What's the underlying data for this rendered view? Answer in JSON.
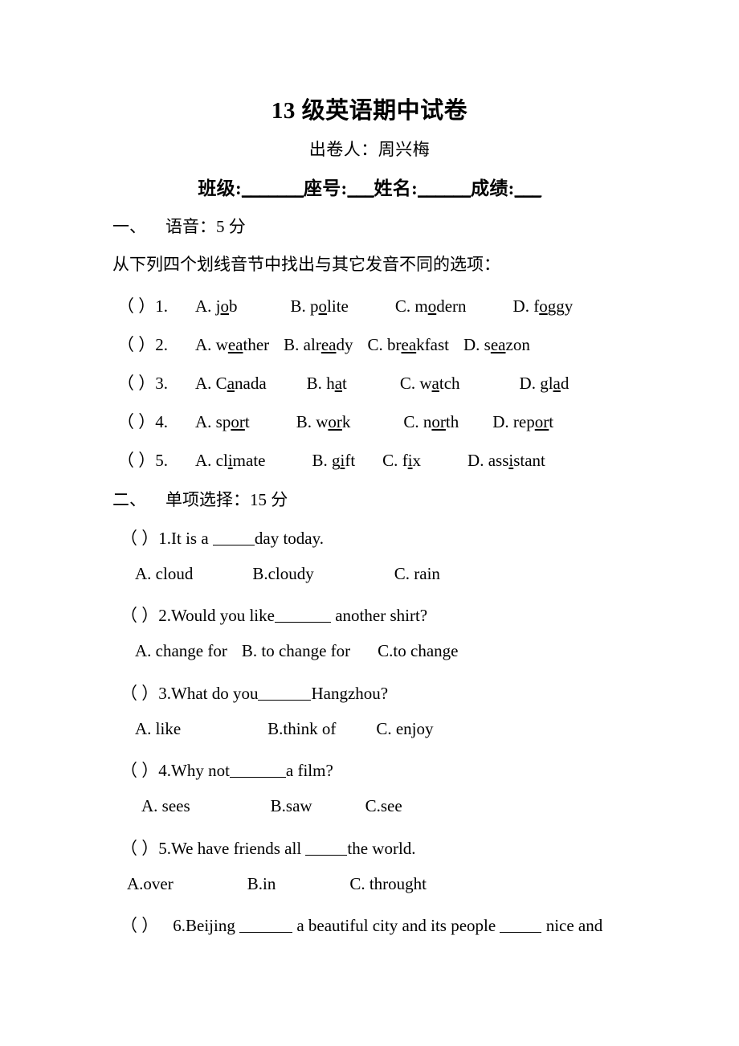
{
  "document": {
    "title": "13 级英语期中试卷",
    "author_line": "出卷人：周兴梅",
    "info_line": {
      "class_label": "班级:",
      "class_blank": "_______",
      "seat_label": "座号:",
      "seat_blank": "___",
      "name_label": "姓名:",
      "name_blank": "______",
      "score_label": "成绩:",
      "score_blank": "___"
    }
  },
  "sections": [
    {
      "number": "一、",
      "title": "语音：5 分",
      "instruction": "从下列四个划线音节中找出与其它发音不同的选项：",
      "questions": [
        {
          "marker": "（ ）",
          "number": "1.",
          "options": [
            {
              "letter": "A. ",
              "pre": "j",
              "mark": "o",
              "post": "b"
            },
            {
              "letter": "B. ",
              "pre": "p",
              "mark": "o",
              "post": "lite"
            },
            {
              "letter": "C. ",
              "pre": "m",
              "mark": "o",
              "post": "dern"
            },
            {
              "letter": "D. ",
              "pre": "f",
              "mark": "o",
              "post": "ggy"
            }
          ]
        },
        {
          "marker": "（ ）",
          "number": "2.",
          "options": [
            {
              "letter": "A. ",
              "pre": "w",
              "mark": "ea",
              "post": "ther"
            },
            {
              "letter": "B. ",
              "pre": "alr",
              "mark": "ea",
              "post": "dy"
            },
            {
              "letter": "C. ",
              "pre": "br",
              "mark": "ea",
              "post": "kfast"
            },
            {
              "letter": "D. ",
              "pre": "s",
              "mark": "ea",
              "post": "zon"
            }
          ]
        },
        {
          "marker": "（ ）",
          "number": "3.",
          "options": [
            {
              "letter": "A. ",
              "pre": "C",
              "mark": "a",
              "post": "nada"
            },
            {
              "letter": "B. ",
              "pre": "h",
              "mark": "a",
              "post": "t"
            },
            {
              "letter": "C. ",
              "pre": "w",
              "mark": "a",
              "post": "tch"
            },
            {
              "letter": "D. ",
              "pre": "gl",
              "mark": "a",
              "post": "d"
            }
          ]
        },
        {
          "marker": "（ ）",
          "number": "4.",
          "options": [
            {
              "letter": "A. ",
              "pre": "sp",
              "mark": "or",
              "post": "t"
            },
            {
              "letter": "B. ",
              "pre": "w",
              "mark": "or",
              "post": "k"
            },
            {
              "letter": "C. ",
              "pre": "n",
              "mark": "or",
              "post": "th"
            },
            {
              "letter": "D. ",
              "pre": "rep",
              "mark": "or",
              "post": "t"
            }
          ]
        },
        {
          "marker": "（ ）",
          "number": "5.",
          "options": [
            {
              "letter": "A. ",
              "pre": "cl",
              "mark": "i",
              "post": "mate"
            },
            {
              "letter": "B. ",
              "pre": "g",
              "mark": "i",
              "post": "ft"
            },
            {
              "letter": "C. ",
              "pre": "f",
              "mark": "i",
              "post": "x"
            },
            {
              "letter": "D. ",
              "pre": "ass",
              "mark": "i",
              "post": "stant"
            }
          ]
        }
      ]
    },
    {
      "number": "二、",
      "title": "单项选择：15 分",
      "questions": [
        {
          "marker": "（ ）",
          "number": "1.",
          "stem_before": "It is a ",
          "stem_after": "day today.",
          "options": [
            "A. cloud",
            "B.cloudy",
            "C. rain"
          ]
        },
        {
          "marker": "（ ）",
          "number": "2.",
          "stem_before": "Would you like",
          "stem_after": " another shirt?",
          "options": [
            "A. change for",
            "B. to change for",
            "C.to change"
          ]
        },
        {
          "marker": "（ ）",
          "number": "3.",
          "stem_before": "What do you",
          "stem_after": "Hangzhou?",
          "options": [
            "A. like",
            "B.think of",
            "C. enjoy"
          ]
        },
        {
          "marker": "（ ）",
          "number": "4.",
          "stem_before": "Why not",
          "stem_after": "a film?",
          "options": [
            "A. sees",
            "B.saw",
            "C.see"
          ]
        },
        {
          "marker": "（ ）",
          "number": "5.",
          "stem_before": "We have friends all ",
          "stem_after": "the world.",
          "options": [
            "A.over",
            "B.in",
            "C. throught"
          ]
        },
        {
          "marker": "（ ）",
          "number": "6.",
          "part1": "Beijing ",
          "part2": " a  beautiful  city  and  its  people ",
          "part3": " nice  and"
        }
      ]
    }
  ]
}
